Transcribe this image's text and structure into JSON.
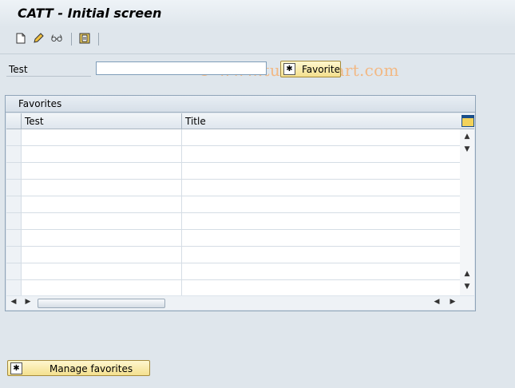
{
  "window": {
    "title": "CATT - Initial screen"
  },
  "toolbar": {
    "icons": [
      "new-document-icon",
      "edit-pencil-icon",
      "display-glasses-icon",
      "execute-icon"
    ],
    "watermark": "© www.tutorialkart.com"
  },
  "form": {
    "test_label": "Test",
    "test_value": "",
    "favorite_button": "Favorite"
  },
  "favorites": {
    "title": "Favorites",
    "columns": [
      "Test",
      "Title"
    ],
    "rows": [
      [
        "",
        ""
      ],
      [
        "",
        ""
      ],
      [
        "",
        ""
      ],
      [
        "",
        ""
      ],
      [
        "",
        ""
      ],
      [
        "",
        ""
      ],
      [
        "",
        ""
      ],
      [
        "",
        ""
      ],
      [
        "",
        ""
      ],
      [
        "",
        ""
      ]
    ]
  },
  "footer": {
    "manage_favorites_button": "Manage favorites"
  }
}
